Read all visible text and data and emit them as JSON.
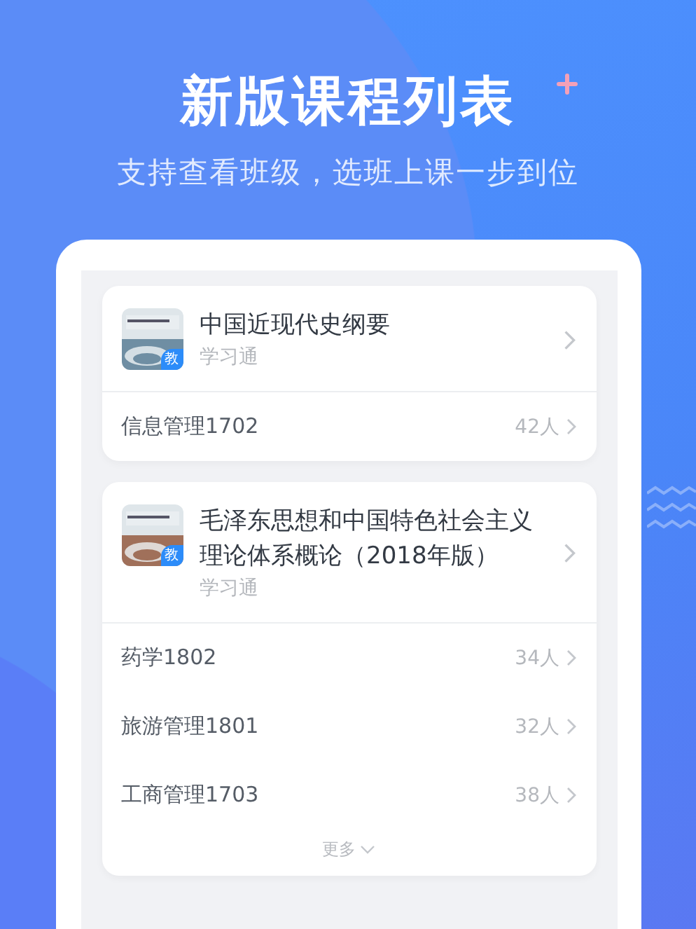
{
  "headline": "新版课程列表",
  "subtitle": "支持查看班级，选班上课一步到位",
  "courses": [
    {
      "title": "中国近现代史纲要",
      "source": "学习通",
      "badge": "教",
      "cover": {
        "kind": "picture"
      },
      "classes": [
        {
          "name": "信息管理1702",
          "count": "42人"
        }
      ]
    },
    {
      "title": "毛泽东思想和中国特色社会主义理论体系概论（2018年版）",
      "source": "学习通",
      "badge": "教",
      "cover": {
        "kind": "picture"
      },
      "classes": [
        {
          "name": "药学1802",
          "count": "34人"
        },
        {
          "name": "旅游管理1801",
          "count": "32人"
        },
        {
          "name": "工商管理1703",
          "count": "38人"
        }
      ],
      "more": "更多"
    }
  ]
}
